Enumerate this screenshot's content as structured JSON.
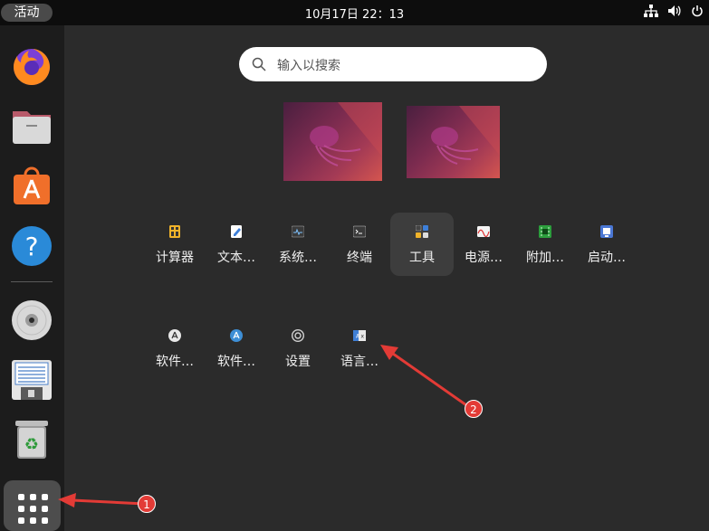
{
  "topbar": {
    "activities_label": "活动",
    "clock": "10月17日  22：13",
    "tray_icons": [
      "network-icon",
      "volume-icon",
      "power-icon"
    ]
  },
  "dock": {
    "items": [
      {
        "name": "firefox-icon"
      },
      {
        "name": "files-icon"
      },
      {
        "name": "app-center-icon"
      },
      {
        "name": "help-icon"
      },
      {
        "name": "disc-icon"
      },
      {
        "name": "save-disk-icon"
      },
      {
        "name": "trash-icon"
      }
    ],
    "show_apps": "grid-icon"
  },
  "search": {
    "placeholder": "输入以搜索"
  },
  "workspaces": [
    {
      "id": 1
    },
    {
      "id": 2
    }
  ],
  "apps": {
    "row1": [
      {
        "label": "计算器",
        "icon": "calculator-icon",
        "color": "#f0b32a"
      },
      {
        "label": "文本…",
        "icon": "text-editor-icon",
        "color": "#3d7fd9"
      },
      {
        "label": "系统…",
        "icon": "system-monitor-icon",
        "color": "#3a3a3a"
      },
      {
        "label": "终端",
        "icon": "terminal-icon",
        "color": "#3a3a3a"
      },
      {
        "label": "工具",
        "icon": "utilities-folder-icon",
        "color": "#3a3a3a"
      },
      {
        "label": "电源…",
        "icon": "power-statistics-icon",
        "color": "#f4f4f4"
      },
      {
        "label": "附加…",
        "icon": "additional-drivers-icon",
        "color": "#2c9e3d"
      },
      {
        "label": "启动…",
        "icon": "startup-disk-icon",
        "color": "#4a77d4"
      }
    ],
    "row2": [
      {
        "label": "软件…",
        "icon": "software-updater-icon",
        "color": "#e8e8e8"
      },
      {
        "label": "软件…",
        "icon": "software-properties-icon",
        "color": "#3e8fd6"
      },
      {
        "label": "设置",
        "icon": "settings-icon",
        "color": "#d0d0d0"
      },
      {
        "label": "语言…",
        "icon": "language-support-icon",
        "color": "#3f7fd6"
      }
    ]
  },
  "annotations": [
    {
      "label": "1"
    },
    {
      "label": "2"
    }
  ],
  "colors": {
    "accent_red": "#e33b36",
    "background": "#2b2b2b",
    "topbar": "#0d0d0d",
    "dock": "#1c1c1c"
  }
}
